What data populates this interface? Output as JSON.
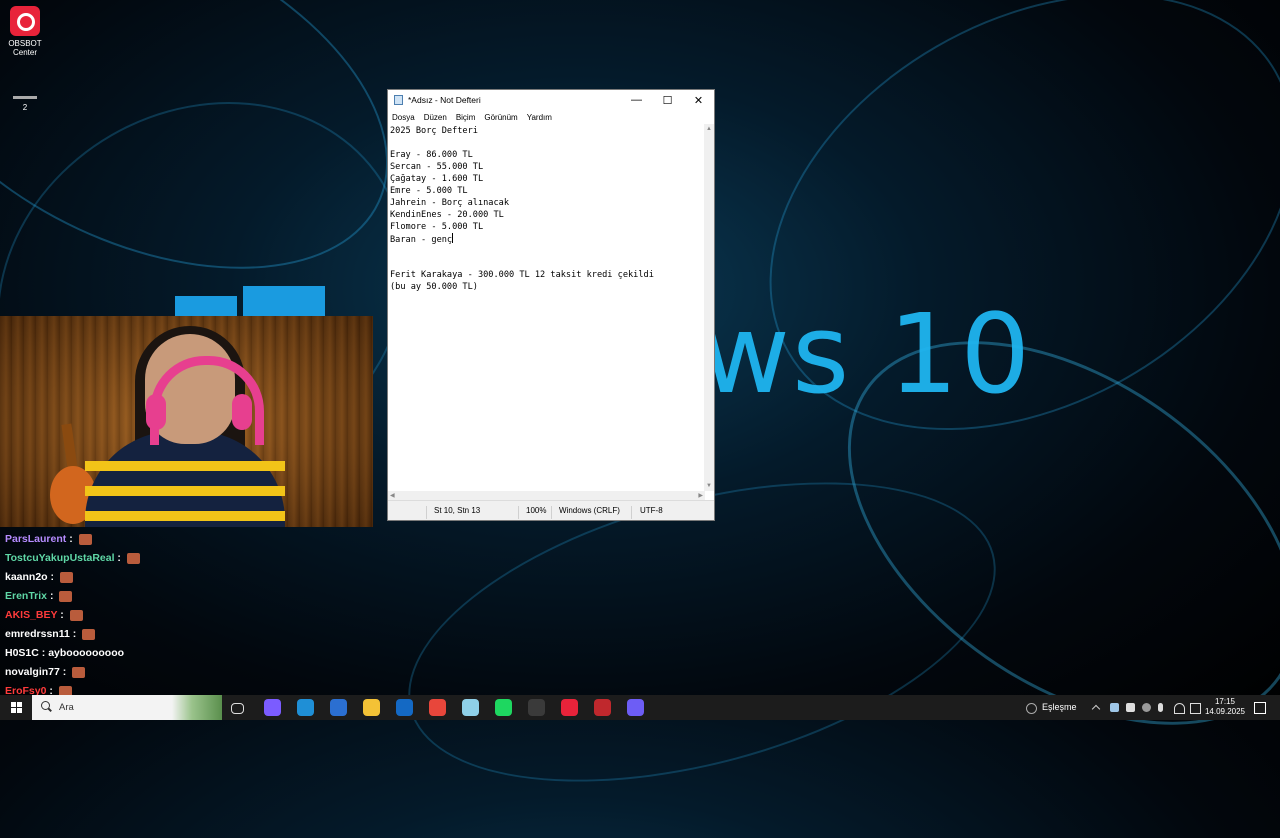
{
  "desktop": {
    "icons": [
      {
        "label_line1": "OBSBOT",
        "label_line2": "Center",
        "icon": "obsbot-icon"
      },
      {
        "label": "2",
        "icon": "folder-icon"
      }
    ],
    "wallpaper_text": "ws 10"
  },
  "notepad": {
    "title": "*Adsız - Not Defteri",
    "menu": [
      "Dosya",
      "Düzen",
      "Biçim",
      "Görünüm",
      "Yardım"
    ],
    "lines": [
      "2025 Borç Defteri",
      "",
      "Eray - 86.000 TL",
      "Sercan - 55.000 TL",
      "Çağatay - 1.600 TL",
      "Emre - 5.000 TL",
      "Jahrein - Borç alınacak",
      "KendinEnes - 20.000 TL",
      "Flomore - 5.000 TL",
      "Baran - genç",
      "",
      "",
      "Ferit Karakaya - 300.000 TL 12 taksit kredi çekildi",
      "(bu ay 50.000 TL)"
    ],
    "status": {
      "position": "St 10, Stn 13",
      "zoom": "100%",
      "line_ending": "Windows (CRLF)",
      "encoding": "UTF-8"
    }
  },
  "chat": [
    {
      "user": "ParsLaurent",
      "color": "#b68cff",
      "message": "",
      "emote": true
    },
    {
      "user": "TostcuYakupUstaReal",
      "color": "#5fd7a6",
      "message": "",
      "emote": true
    },
    {
      "user": "kaann2o",
      "color": "#ffffff",
      "message": "",
      "emote": true
    },
    {
      "user": "ErenTrix",
      "color": "#5fd7a6",
      "message": "",
      "emote": true
    },
    {
      "user": "AKIS_BEY",
      "color": "#ff3b3b",
      "message": "",
      "emote": true
    },
    {
      "user": "emredrssn11",
      "color": "#ffffff",
      "message": "",
      "emote": true
    },
    {
      "user": "H0S1C",
      "color": "#ffffff",
      "message": "aybooooooooo",
      "emote": false
    },
    {
      "user": "novalgin77",
      "color": "#ffffff",
      "message": "",
      "emote": true
    },
    {
      "user": "EroFsy0",
      "color": "#ff3b3b",
      "message": "",
      "emote": true
    }
  ],
  "taskbar": {
    "search_placeholder": "Ara",
    "apps": [
      {
        "icon": "task-view-icon",
        "color": "#1c1c1c"
      },
      {
        "icon": "copilot-icon",
        "color": "#7b5cff"
      },
      {
        "icon": "edge-icon",
        "color": "#1f8fd6"
      },
      {
        "icon": "store-icon",
        "color": "#2b6fd1"
      },
      {
        "icon": "file-explorer-icon",
        "color": "#f4c236"
      },
      {
        "icon": "outlook-icon",
        "color": "#1469c4"
      },
      {
        "icon": "chrome-icon",
        "color": "#e8463b"
      },
      {
        "icon": "notepad-icon",
        "color": "#8fd0e8"
      },
      {
        "icon": "spotify-icon",
        "color": "#1ed760"
      },
      {
        "icon": "clock-app-icon",
        "color": "#3a3a3a"
      },
      {
        "icon": "obsbot-icon",
        "color": "#e8233a"
      },
      {
        "icon": "voicemeeter-icon",
        "color": "#c0282d"
      },
      {
        "icon": "discord-icon",
        "color": "#6d5df5"
      }
    ],
    "tray_label": "Eşleşme",
    "time": "17:15",
    "date": "14.09.2025"
  }
}
